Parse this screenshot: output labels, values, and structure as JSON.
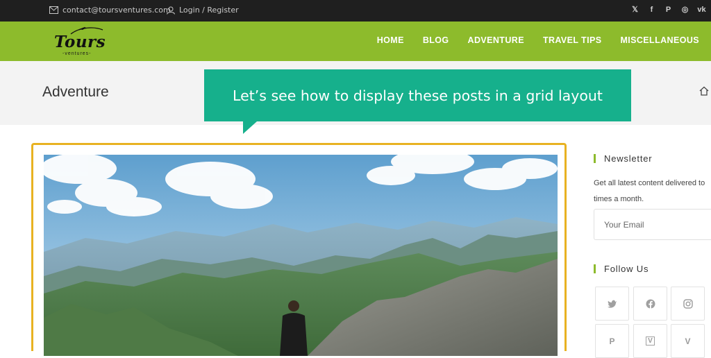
{
  "topbar": {
    "contact_email": "contact@toursventures.com",
    "login_label": "Login / Register",
    "social": [
      {
        "icon": "twitter-icon",
        "glyph": "𝕏"
      },
      {
        "icon": "facebook-icon",
        "glyph": "f"
      },
      {
        "icon": "pinterest-icon",
        "glyph": "P"
      },
      {
        "icon": "dribbble-icon",
        "glyph": "◎"
      },
      {
        "icon": "vk-icon",
        "glyph": "vk"
      }
    ]
  },
  "logo": {
    "word": "Tours",
    "sub": "-ventures-"
  },
  "nav": {
    "items": [
      "HOME",
      "BLOG",
      "ADVENTURE",
      "TRAVEL TIPS",
      "MISCELLANEOUS"
    ]
  },
  "page": {
    "title": "Adventure"
  },
  "callout": {
    "text": "Let’s see how to display these posts in a grid layout"
  },
  "sidebar": {
    "newsletter_title": "Newsletter",
    "newsletter_text_1": "Get all latest content delivered to",
    "newsletter_text_2": "times a month.",
    "email_placeholder": "Your Email",
    "follow_title": "Follow Us"
  },
  "colors": {
    "brand_green": "#8dbb2c",
    "callout": "#16b08c",
    "highlight": "#e8b222",
    "topbar": "#1f1f1f"
  }
}
